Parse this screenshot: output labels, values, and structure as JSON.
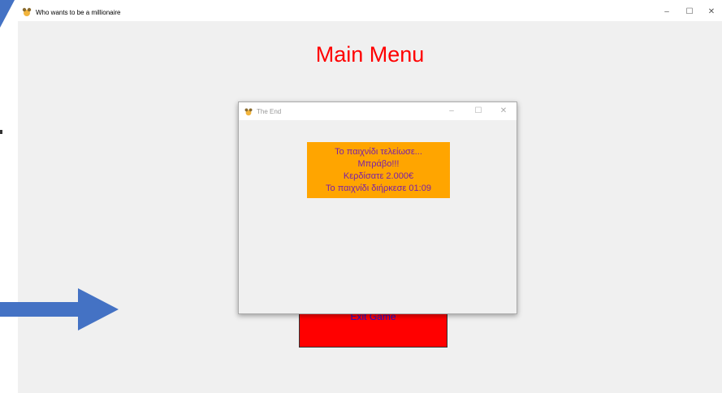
{
  "main_window": {
    "title": "Who wants to be a millionaire",
    "controls": {
      "minimize": "–",
      "maximize": "☐",
      "close": "✕"
    }
  },
  "main_menu": {
    "heading": "Main Menu",
    "exit_button_label": "Exit Game"
  },
  "dialog": {
    "title": "The End",
    "controls": {
      "minimize": "–",
      "maximize": "☐",
      "close": "✕"
    },
    "lines": [
      "Το παιχνίδι τελείωσε...",
      "Μπράβο!!!",
      "Κερδίσατε  2.000€",
      "Το παιχνίδι διήρκεσε 01:09"
    ]
  },
  "colors": {
    "heading": "#ff0000",
    "exit_button_bg": "#ff0000",
    "result_box_bg": "#ffa500",
    "result_text": "#7a1fa8",
    "arrow": "#4472c4"
  },
  "icons": [
    "app-icon",
    "minimize-icon",
    "maximize-icon",
    "close-icon",
    "arrow-icon"
  ]
}
